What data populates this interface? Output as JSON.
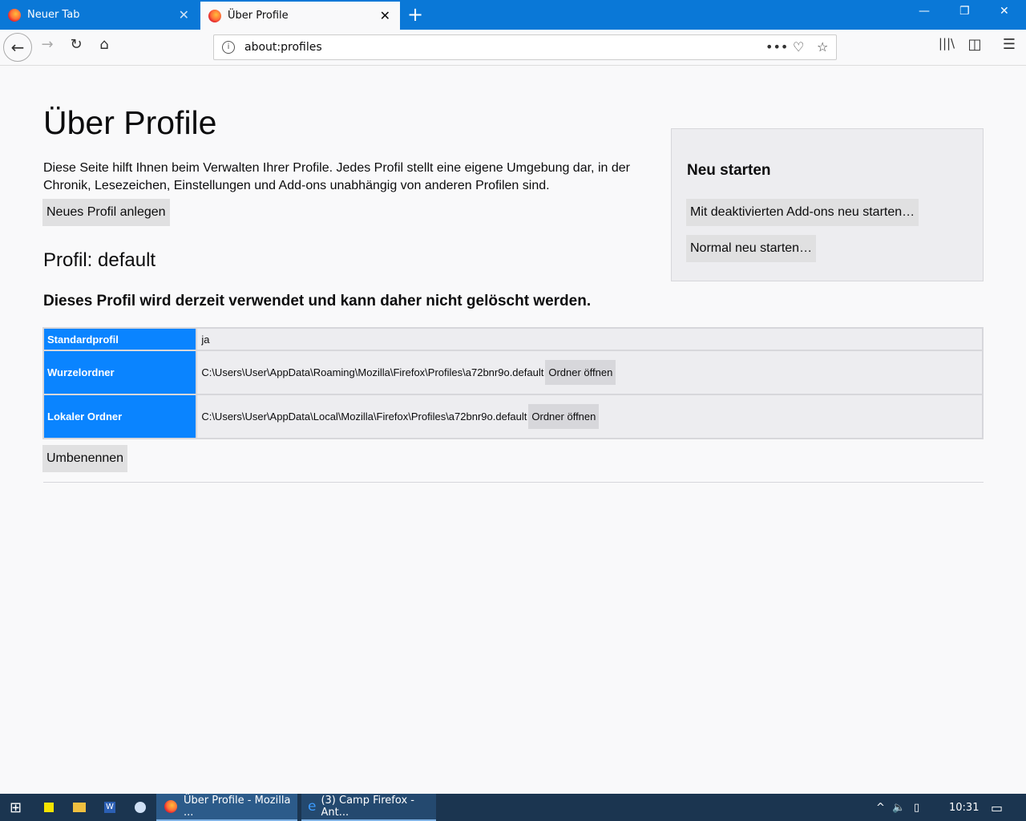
{
  "tabs": [
    {
      "label": "Neuer Tab"
    },
    {
      "label": "Über Profile"
    }
  ],
  "url": "about:profiles",
  "page": {
    "title": "Über Profile",
    "intro": "Diese Seite hilft Ihnen beim Verwalten Ihrer Profile. Jedes Profil stellt eine eigene Umgebung dar, in der Chronik, Lesezeichen, Einstellungen und Add-ons unabhängig von anderen Profilen sind.",
    "new_profile": "Neues Profil anlegen",
    "restart": {
      "heading": "Neu starten",
      "safe": "Mit deaktivierten Add-ons neu starten…",
      "normal": "Normal neu starten…"
    },
    "profile_heading": "Profil: default",
    "in_use": "Dieses Profil wird derzeit verwendet und kann daher nicht gelöscht werden.",
    "rows": [
      {
        "label": "Standardprofil",
        "value": "ja"
      },
      {
        "label": "Wurzelordner",
        "value": "C:\\Users\\User\\AppData\\Roaming\\Mozilla\\Firefox\\Profiles\\a72bnr9o.default",
        "button": "Ordner öffnen"
      },
      {
        "label": "Lokaler Ordner",
        "value": "C:\\Users\\User\\AppData\\Local\\Mozilla\\Firefox\\Profiles\\a72bnr9o.default",
        "button": "Ordner öffnen"
      }
    ],
    "rename": "Umbenennen"
  },
  "taskbar": {
    "items": [
      {
        "label": "Über Profile - Mozilla ..."
      },
      {
        "label": "(3) Camp Firefox - Ant..."
      }
    ],
    "clock": "10:31"
  }
}
